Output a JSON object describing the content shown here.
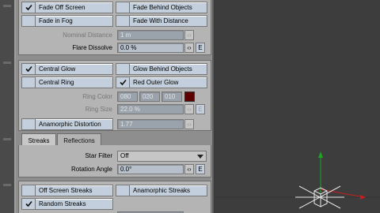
{
  "top_section": {
    "fade_off_screen": {
      "label": "Fade Off Screen",
      "checked": true
    },
    "fade_behind_objects": {
      "label": "Fade Behind Objects",
      "checked": false
    },
    "fade_in_fog": {
      "label": "Fade in Fog",
      "checked": false
    },
    "fade_with_distance": {
      "label": "Fade With Distance",
      "checked": false
    },
    "nominal_distance": {
      "label": "Nominal Distance",
      "value": "1 m"
    },
    "flare_dissolve": {
      "label": "Flare Dissolve",
      "value": "0.0 %",
      "env_label": "E"
    }
  },
  "mid_section": {
    "central_glow": {
      "label": "Central Glow",
      "checked": true
    },
    "glow_behind_objects": {
      "label": "Glow Behind Objects",
      "checked": false
    },
    "central_ring": {
      "label": "Central Ring",
      "checked": false
    },
    "red_outer_glow": {
      "label": "Red Outer Glow",
      "checked": true
    },
    "ring_color": {
      "label": "Ring Color",
      "r": "080",
      "g": "020",
      "b": "010",
      "swatch": "#5c0000"
    },
    "ring_size": {
      "label": "Ring Size",
      "value": "22.0 %",
      "env_label": "E"
    },
    "anamorphic_distortion": {
      "label": "Anamorphic Distortion",
      "value": "1.77",
      "checked": false
    }
  },
  "tabs": [
    {
      "label": "Streaks",
      "active": true
    },
    {
      "label": "Reflections",
      "active": false
    }
  ],
  "streaks": {
    "star_filter": {
      "label": "Star Filter",
      "value": "Off"
    },
    "rotation_angle": {
      "label": "Rotation Angle",
      "value": "0.0°",
      "env_label": "E"
    },
    "off_screen_streaks": {
      "label": "Off Screen Streaks",
      "checked": false
    },
    "anamorphic_streaks": {
      "label": "Anamorphic Streaks",
      "checked": false
    },
    "random_streaks": {
      "label": "Random Streaks",
      "checked": true
    }
  },
  "colors": {
    "panel": "#b4b4b4",
    "button": "#c3cfdc",
    "viewport": "#3d3d3d",
    "axis_green": "#1ea51e",
    "axis_red": "#c81e1e"
  }
}
